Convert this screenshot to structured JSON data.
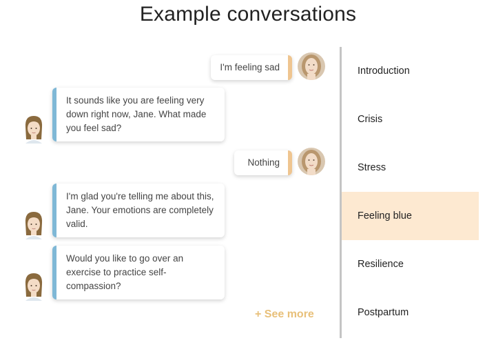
{
  "title": "Example conversations",
  "conversation": {
    "user_messages": [
      "I'm feeling sad",
      "Nothing"
    ],
    "bot_messages": [
      "It sounds like you are feeling very down right now, Jane. What made you feel sad?",
      "I'm glad you're telling me about this, Jane. Your emotions are completely valid.",
      "Would you like to go over an exercise to practice self-compassion?"
    ],
    "see_more": "+ See more"
  },
  "topics": [
    {
      "label": "Introduction",
      "active": false
    },
    {
      "label": "Crisis",
      "active": false
    },
    {
      "label": "Stress",
      "active": false
    },
    {
      "label": "Feeling blue",
      "active": true
    },
    {
      "label": "Resilience",
      "active": false
    },
    {
      "label": "Postpartum",
      "active": false
    }
  ],
  "colors": {
    "user_accent": "#efc590",
    "bot_accent": "#7fb8d6",
    "active_topic_bg": "#fde9d1",
    "see_more": "#e8c07a"
  }
}
